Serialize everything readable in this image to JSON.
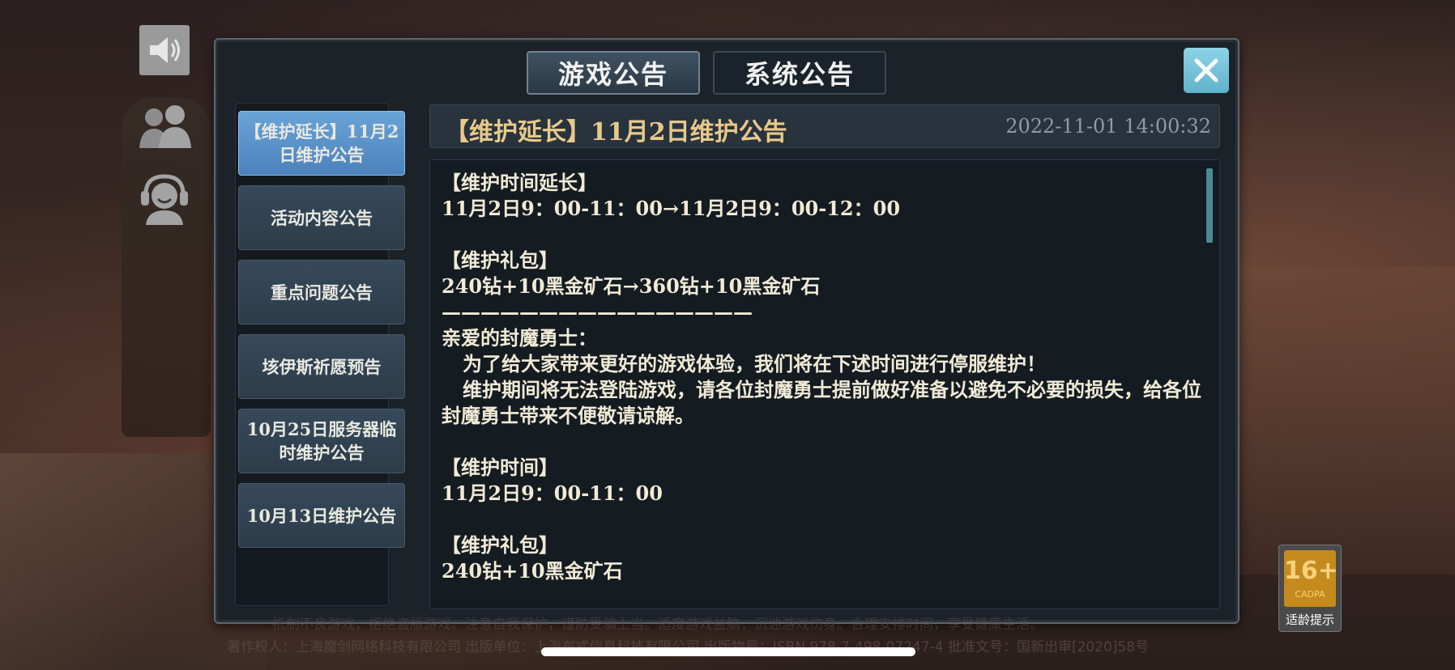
{
  "tabs": [
    {
      "label": "游戏公告",
      "active": true
    },
    {
      "label": "系统公告",
      "active": false
    }
  ],
  "list": [
    {
      "label": "【维护延长】11月2日维护公告",
      "active": true
    },
    {
      "label": "活动内容公告",
      "active": false
    },
    {
      "label": "重点问题公告",
      "active": false
    },
    {
      "label": "垓伊斯祈愿预告",
      "active": false
    },
    {
      "label": "10月25日服务器临时维护公告",
      "active": false
    },
    {
      "label": "10月13日维护公告",
      "active": false
    }
  ],
  "announcement": {
    "title": "【维护延长】11月2日维护公告",
    "datetime": "2022-11-01  14:00:32",
    "lines": {
      "l1": "【维护时间延长】",
      "l2": "11月2日9：00-11：00→11月2日9：00-12：00",
      "l3": "【维护礼包】",
      "l4": "240钻+10黑金矿石→360钻+10黑金矿石",
      "l5": "————————————————",
      "l6": "亲爱的封魔勇士：",
      "l7": "为了给大家带来更好的游戏体验，我们将在下述时间进行停服维护！",
      "l8": "维护期间将无法登陆游戏，请各位封魔勇士提前做好准备以避免不必要的损失，给各位封魔勇士带来不便敬请谅解。",
      "l9": "【维护时间】",
      "l10": "11月2日9：00-11：00",
      "l11": "【维护礼包】",
      "l12": "240钻+10黑金矿石"
    }
  },
  "age_rating": {
    "age": "16+",
    "org": "CADPA",
    "label": "适龄提示"
  },
  "footer": {
    "notice": "抵制不良游戏，拒绝盗版游戏。注意自我保护，谨防受骗上当。适度游戏益脑，沉迷游戏伤身。合理安排时间，享受健康生活。",
    "publisher": "著作权人：上海魔剑网络科技有限公司  出版单位：上海布式信息科技有限公司  出版物号：ISBN 978-7-498-07247-4  批准文号：国新出审[2020]58号"
  },
  "icons": {
    "speaker": "speaker-icon",
    "friends": "friends-icon",
    "support": "support-icon",
    "close": "close-icon"
  }
}
